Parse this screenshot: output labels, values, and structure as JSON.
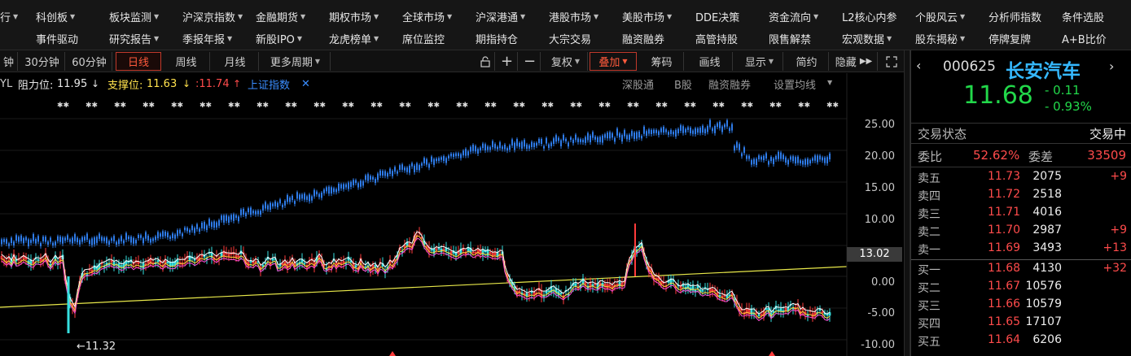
{
  "menu_row1": [
    {
      "label": "行",
      "caret": true
    },
    {
      "label": "科创板",
      "caret": true
    },
    {
      "label": "板块监测",
      "caret": true
    },
    {
      "label": "沪深京指数",
      "caret": true
    },
    {
      "label": "金融期货",
      "caret": true
    },
    {
      "label": "期权市场",
      "caret": true
    },
    {
      "label": "全球市场",
      "caret": true
    },
    {
      "label": "沪深港通",
      "caret": true
    },
    {
      "label": "港股市场",
      "caret": true
    },
    {
      "label": "美股市场",
      "caret": true
    },
    {
      "label": "DDE决策",
      "caret": false
    },
    {
      "label": "资金流向",
      "caret": true
    },
    {
      "label": "L2核心内参",
      "caret": false
    },
    {
      "label": "个股风云",
      "caret": true
    },
    {
      "label": "分析师指数",
      "caret": false
    },
    {
      "label": "条件选股",
      "caret": false
    }
  ],
  "menu_row2": [
    {
      "label": "事件驱动",
      "caret": false
    },
    {
      "label": "研究报告",
      "caret": true
    },
    {
      "label": "季报年报",
      "caret": true
    },
    {
      "label": "新股IPO",
      "caret": true
    },
    {
      "label": "龙虎榜单",
      "caret": true
    },
    {
      "label": "席位监控",
      "caret": false
    },
    {
      "label": "期指持仓",
      "caret": false
    },
    {
      "label": "大宗交易",
      "caret": false
    },
    {
      "label": "融资融券",
      "caret": false
    },
    {
      "label": "高管持股",
      "caret": false
    },
    {
      "label": "限售解禁",
      "caret": false
    },
    {
      "label": "宏观数据",
      "caret": true
    },
    {
      "label": "股东揭秘",
      "caret": true
    },
    {
      "label": "停牌复牌",
      "caret": false
    },
    {
      "label": "A+B比价",
      "caret": false
    }
  ],
  "toolbar": {
    "periods": [
      "钟",
      "30分钟",
      "60分钟",
      "日线",
      "周线",
      "月线"
    ],
    "active_period": "日线",
    "more_periods": "更多周期",
    "lock": "🔓",
    "plus": "+",
    "minus": "−",
    "fuquan": "复权",
    "overlay": "叠加",
    "chips": "筹码",
    "draw": "画线",
    "display": "显示",
    "simple": "简约",
    "hide": "隐藏",
    "expand": "▸▸",
    "fullscreen": "⛶"
  },
  "infobar": {
    "prefix": "YL",
    "resistance_label": "阻力位:",
    "resistance_value": "11.95",
    "support_label": "支撑位:",
    "support_value": "11.63",
    "extra_value": ":11.74",
    "overlay_index": "上证指数",
    "right_links": [
      "深股通",
      "B股",
      "融资融券",
      "设置均线"
    ]
  },
  "chart_data": {
    "type": "candlestick",
    "y_axis_ticks": [
      "25.00",
      "20.00",
      "15.00",
      "10.00",
      "0.00",
      "-5.00",
      "-10.00"
    ],
    "current_tag": "13.02",
    "low_annotation": "←11.32",
    "note": "Main series: 长安汽车 daily candles with 上证指数 overlay (blue) and yellow trend line"
  },
  "quote": {
    "code": "000625",
    "name": "长安汽车",
    "price": "11.68",
    "change": "- 0.11",
    "change_pct": "- 0.93%",
    "status_label": "交易状态",
    "status_value": "交易中",
    "weibi_label": "委比",
    "weibi_value": "52.62%",
    "weicha_label": "委差",
    "weicha_value": "33509",
    "asks": [
      {
        "label": "卖五",
        "price": "11.73",
        "volume": "2075",
        "delta": "+9"
      },
      {
        "label": "卖四",
        "price": "11.72",
        "volume": "2518",
        "delta": ""
      },
      {
        "label": "卖三",
        "price": "11.71",
        "volume": "4016",
        "delta": ""
      },
      {
        "label": "卖二",
        "price": "11.70",
        "volume": "2987",
        "delta": "+9"
      },
      {
        "label": "卖一",
        "price": "11.69",
        "volume": "3493",
        "delta": "+13"
      }
    ],
    "bids": [
      {
        "label": "买一",
        "price": "11.68",
        "volume": "4130",
        "delta": "+32"
      },
      {
        "label": "买二",
        "price": "11.67",
        "volume": "10576",
        "delta": ""
      },
      {
        "label": "买三",
        "price": "11.66",
        "volume": "10579",
        "delta": ""
      },
      {
        "label": "买四",
        "price": "11.65",
        "volume": "17107",
        "delta": ""
      },
      {
        "label": "买五",
        "price": "11.64",
        "volume": "6206",
        "delta": ""
      }
    ]
  }
}
